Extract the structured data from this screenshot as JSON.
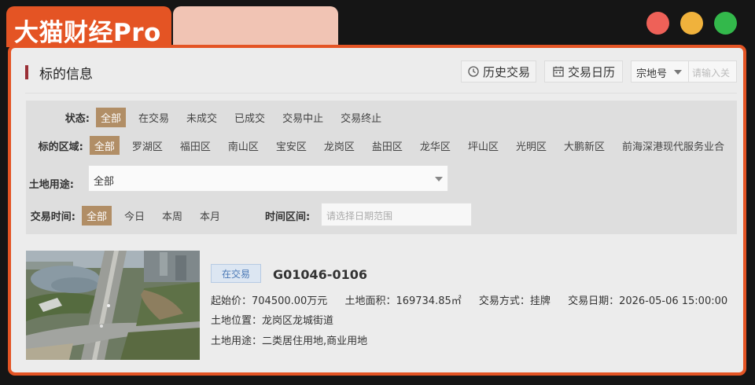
{
  "app": {
    "brand": "大猫财经Pro"
  },
  "window": {
    "traffic_lights": [
      "#ee6158",
      "#f0b23c",
      "#33b84b"
    ],
    "accent": "#e45424"
  },
  "section": {
    "title": "标的信息"
  },
  "toolbar": {
    "history_label": "历史交易",
    "history_icon": "clock-icon",
    "calendar_label": "交易日历",
    "calendar_icon": "calendar-icon",
    "search_type": "宗地号",
    "search_placeholder": "请输入关"
  },
  "filters": {
    "status": {
      "label": "状态:",
      "options": [
        "全部",
        "在交易",
        "未成交",
        "已成交",
        "交易中止",
        "交易终止"
      ],
      "active": 0
    },
    "area": {
      "label": "标的区域:",
      "options": [
        "全部",
        "罗湖区",
        "福田区",
        "南山区",
        "宝安区",
        "龙岗区",
        "盐田区",
        "龙华区",
        "坪山区",
        "光明区",
        "大鹏新区",
        "前海深港现代服务业合"
      ],
      "active": 0
    },
    "land_use": {
      "label": "土地用途:",
      "value": "全部"
    },
    "time": {
      "label": "交易时间:",
      "options": [
        "全部",
        "今日",
        "本周",
        "本月"
      ],
      "active": 0,
      "interval_label": "时间区间:",
      "date_placeholder": "请选择日期范围"
    },
    "active_color": "#b18e66"
  },
  "listing": {
    "status_badge": "在交易",
    "code": "G01046-0106",
    "start_price": "起始价：704500.00万元",
    "land_area": "土地面积：169734.85㎡",
    "trade_method": "交易方式：挂牌",
    "trade_date": "交易日期：2026-05-06 15:00:00",
    "location": "土地位置：龙岗区龙城街道",
    "land_use": "土地用途：二类居住用地,商业用地"
  }
}
